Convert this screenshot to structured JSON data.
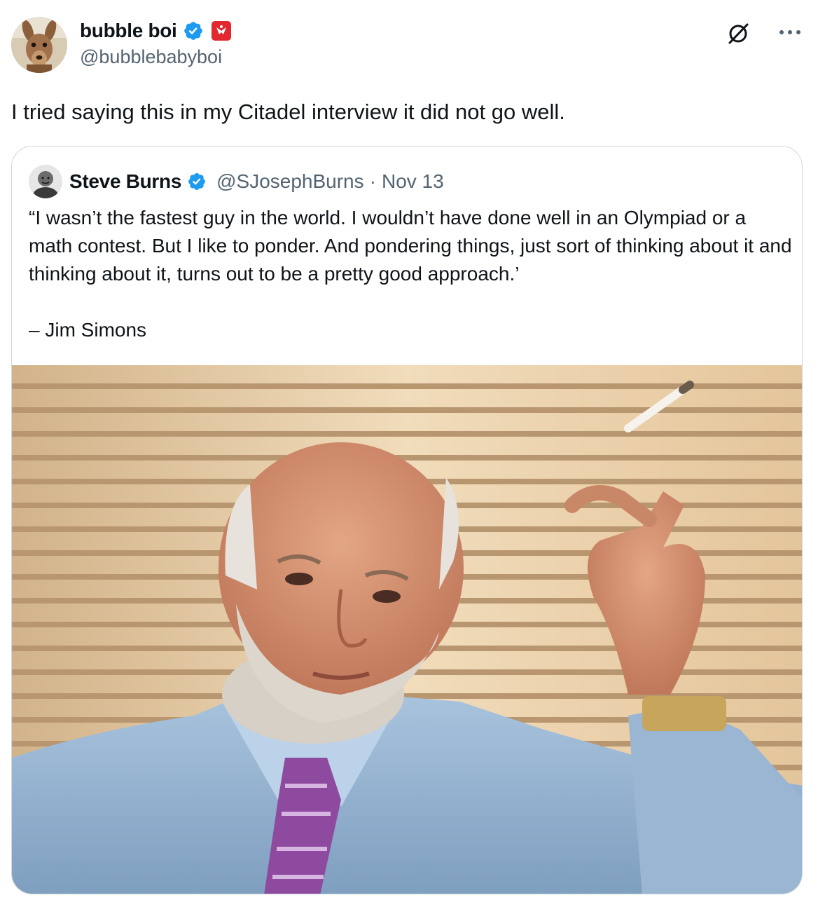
{
  "author": {
    "name": "bubble boi",
    "handle": "@bubblebabyboi",
    "avatar_icon": "kangaroo-avatar",
    "verified_color": "#1d9bf0",
    "affiliate_badge_color": "#e0282e"
  },
  "tweet": {
    "text": "I tried saying this in my Citadel interview it did not go well."
  },
  "actions": {
    "grok_icon": "grok-icon",
    "more_label": "···"
  },
  "quote": {
    "name": "Steve Burns",
    "handle": "@SJosephBurns",
    "separator": "·",
    "date": "Nov 13",
    "text_line": "“I wasn’t the fastest guy in the world. I wouldn’t have done well in an Olympiad or a math contest. But I like to ponder. And pondering things, just sort of thinking about it and thinking about it, turns out to be a pretty good approach.’",
    "attribution": "– Jim Simons",
    "image_subject": "photo-man-with-cigarette"
  },
  "colors": {
    "text": "#0f1419",
    "secondary": "#536471",
    "border": "#cfd9de",
    "verified": "#1d9bf0"
  }
}
